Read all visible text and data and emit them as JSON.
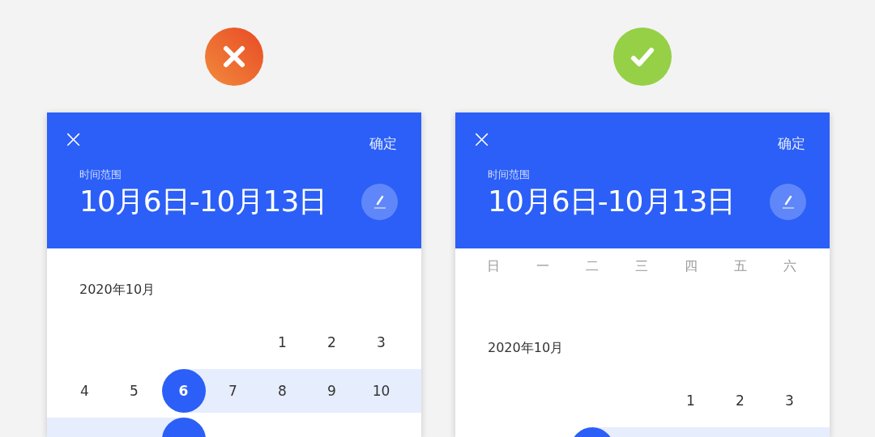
{
  "panels": [
    {
      "kind": "wrong",
      "close": "×",
      "confirm": "确定",
      "range_label": "时间范围",
      "range_value": "10月6日-10月13日",
      "month": "2020年10月",
      "weeks": [
        [
          {
            "kind": "blank"
          },
          {
            "kind": "blank"
          },
          {
            "kind": "blank"
          },
          {
            "kind": "blank"
          },
          {
            "kind": "day",
            "label": "1"
          },
          {
            "kind": "day",
            "label": "2"
          },
          {
            "kind": "day",
            "label": "3"
          }
        ],
        [
          {
            "kind": "day",
            "label": "4"
          },
          {
            "kind": "day",
            "label": "5"
          },
          {
            "kind": "range_start",
            "label": "6"
          },
          {
            "kind": "in_range",
            "label": "7"
          },
          {
            "kind": "in_range",
            "label": "8"
          },
          {
            "kind": "in_range",
            "label": "9"
          },
          {
            "kind": "in_range",
            "label": "10"
          }
        ],
        [
          {
            "kind": "in_range"
          },
          {
            "kind": "in_range"
          },
          {
            "kind": "range_end"
          },
          {
            "kind": "blank"
          },
          {
            "kind": "blank"
          },
          {
            "kind": "blank"
          },
          {
            "kind": "blank"
          }
        ]
      ]
    },
    {
      "kind": "right",
      "close": "×",
      "confirm": "确定",
      "range_label": "时间范围",
      "range_value": "10月6日-10月13日",
      "weekdays": [
        "日",
        "一",
        "二",
        "三",
        "四",
        "五",
        "六"
      ],
      "month": "2020年10月",
      "weeks": [
        [
          {
            "kind": "blank"
          },
          {
            "kind": "blank"
          },
          {
            "kind": "blank"
          },
          {
            "kind": "blank"
          },
          {
            "kind": "day",
            "label": "1"
          },
          {
            "kind": "day",
            "label": "2"
          },
          {
            "kind": "day",
            "label": "3"
          }
        ],
        [
          {
            "kind": "blank"
          },
          {
            "kind": "blank"
          },
          {
            "kind": "range_start"
          },
          {
            "kind": "in_range"
          },
          {
            "kind": "in_range"
          },
          {
            "kind": "in_range"
          },
          {
            "kind": "in_range"
          }
        ]
      ]
    }
  ]
}
